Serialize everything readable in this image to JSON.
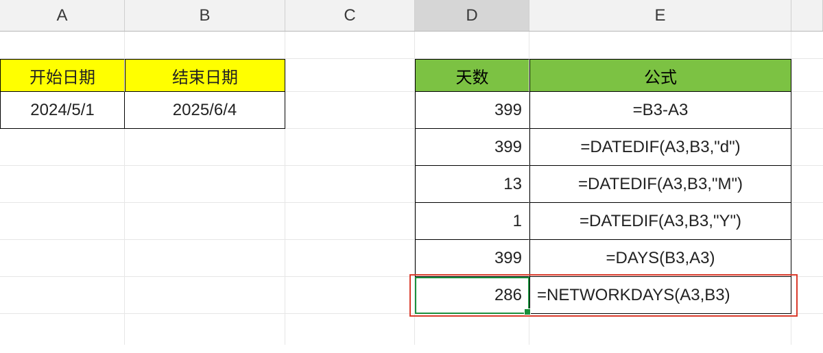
{
  "columns": {
    "A": "A",
    "B": "B",
    "C": "C",
    "D": "D",
    "E": "E"
  },
  "active_column": "D",
  "headers_left": {
    "start": "开始日期",
    "end": "结束日期"
  },
  "dates": {
    "start": "2024/5/1",
    "end": "2025/6/4"
  },
  "headers_right": {
    "days": "天数",
    "formula": "公式"
  },
  "results": [
    {
      "value": "399",
      "formula": "=B3-A3"
    },
    {
      "value": "399",
      "formula": "=DATEDIF(A3,B3,\"d\")"
    },
    {
      "value": "13",
      "formula": "=DATEDIF(A3,B3,\"M\")"
    },
    {
      "value": "1",
      "formula": "=DATEDIF(A3,B3,\"Y\")"
    },
    {
      "value": "399",
      "formula": "=DAYS(B3,A3)"
    },
    {
      "value": "286",
      "formula": "=NETWORKDAYS(A3,B3)"
    }
  ],
  "chart_data": {
    "type": "table",
    "title": "Date difference formulas",
    "inputs": {
      "开始日期": "2024/5/1",
      "结束日期": "2025/6/4"
    },
    "columns": [
      "天数",
      "公式"
    ],
    "rows": [
      [
        399,
        "=B3-A3"
      ],
      [
        399,
        "=DATEDIF(A3,B3,\"d\")"
      ],
      [
        13,
        "=DATEDIF(A3,B3,\"M\")"
      ],
      [
        1,
        "=DATEDIF(A3,B3,\"Y\")"
      ],
      [
        399,
        "=DAYS(B3,A3)"
      ],
      [
        286,
        "=NETWORKDAYS(A3,B3)"
      ]
    ]
  }
}
